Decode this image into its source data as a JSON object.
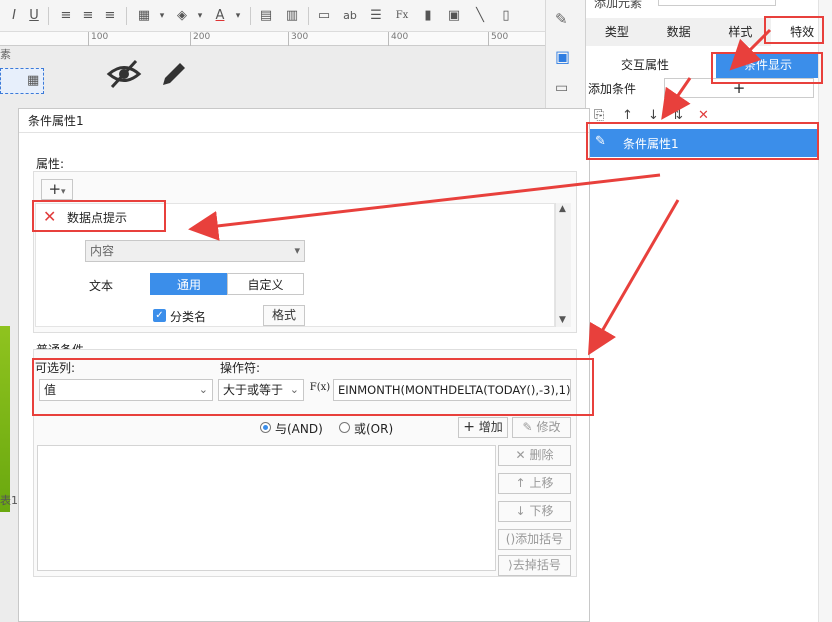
{
  "ruler": {
    "ticks": [
      "100",
      "200",
      "300",
      "400",
      "500"
    ],
    "canvas_fragment": "素"
  },
  "canvas": {
    "row_label_fragment": "表1"
  },
  "right_panel": {
    "top_label": "添加元素",
    "tabs": [
      "类型",
      "数据",
      "样式",
      "特效"
    ],
    "active_tab": "特效",
    "subtabs": [
      "交互属性",
      "条件显示"
    ],
    "active_subtab": "条件显示",
    "add_condition_label": "添加条件",
    "add_symbol": "+",
    "condition_items": [
      {
        "label": "条件属性1",
        "selected": true
      }
    ]
  },
  "dialog": {
    "title": "条件属性1",
    "attributes_section": "属性:",
    "add_button_symbol": "+",
    "attribute_item": "数据点提示",
    "content_label": "内容",
    "text_label": "文本",
    "text_modes": [
      "通用",
      "自定义"
    ],
    "active_text_mode": "通用",
    "category_checkbox_label": "分类名",
    "category_checked": true,
    "format_button": "格式",
    "common_conditions": "普通条件",
    "optional_column_label": "可选列:",
    "operator_label": "操作符:",
    "column_value": "值",
    "operator_value": "大于或等于",
    "fx_label": "F(x)",
    "formula_value": "EINMONTH(MONTHDELTA(TODAY(),-3),1)",
    "logic_and": "与(AND)",
    "logic_or": "或(OR)",
    "logic_selected": "and",
    "add_button": "增加",
    "modify_button": "修改",
    "delete_button": "删除",
    "move_up_button": "上移",
    "move_down_button": "下移",
    "add_bracket_button": "添加括号",
    "remove_bracket_button": "去掉括号"
  },
  "colors": {
    "accent": "#3b8eea",
    "highlight": "#e8403c"
  }
}
